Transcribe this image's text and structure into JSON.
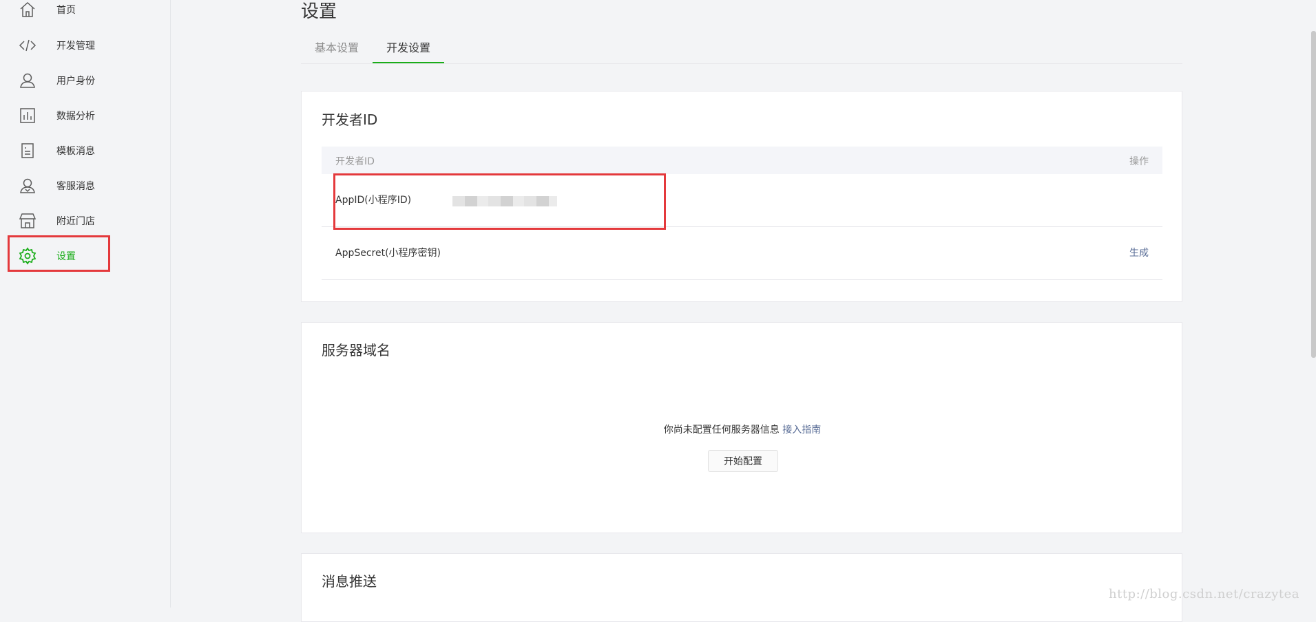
{
  "sidebar": {
    "items": [
      {
        "label": "首页",
        "icon": "home-icon"
      },
      {
        "label": "开发管理",
        "icon": "code-icon"
      },
      {
        "label": "用户身份",
        "icon": "user-icon"
      },
      {
        "label": "数据分析",
        "icon": "chart-icon"
      },
      {
        "label": "模板消息",
        "icon": "document-icon"
      },
      {
        "label": "客服消息",
        "icon": "customer-service-icon"
      },
      {
        "label": "附近门店",
        "icon": "store-icon"
      },
      {
        "label": "设置",
        "icon": "gear-icon",
        "active": true
      }
    ]
  },
  "page": {
    "title": "设置",
    "tabs": [
      {
        "label": "基本设置",
        "active": false
      },
      {
        "label": "开发设置",
        "active": true
      }
    ]
  },
  "developer_id": {
    "title": "开发者ID",
    "table": {
      "header_left": "开发者ID",
      "header_right": "操作",
      "rows": [
        {
          "name": "AppID(小程序ID)",
          "value_masked": true,
          "action": ""
        },
        {
          "name": "AppSecret(小程序密钥)",
          "action": "生成"
        }
      ]
    }
  },
  "server_domain": {
    "title": "服务器域名",
    "empty_text": "你尚未配置任何服务器信息",
    "guide_link": "接入指南",
    "start_button": "开始配置"
  },
  "message_push": {
    "title": "消息推送"
  },
  "watermark": "http://blog.csdn.net/crazytea",
  "colors": {
    "accent": "#1aad19",
    "link": "#576b95",
    "highlight": "#e4393c"
  }
}
